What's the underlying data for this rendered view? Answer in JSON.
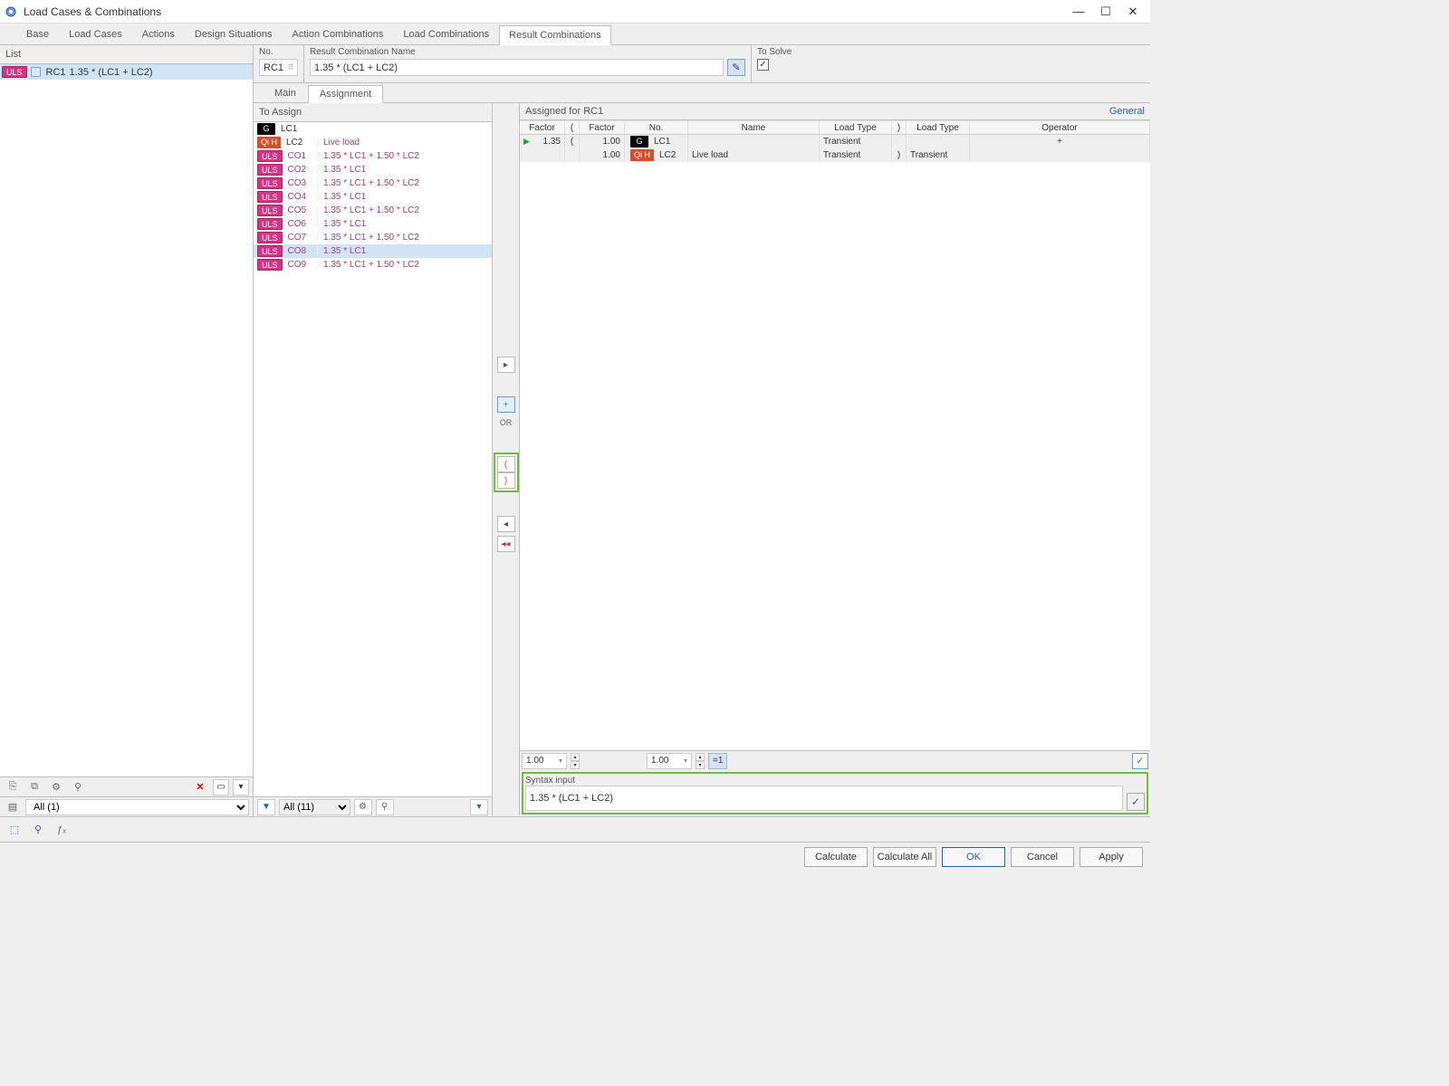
{
  "window": {
    "title": "Load Cases & Combinations"
  },
  "tabs": {
    "items": [
      "Base",
      "Load Cases",
      "Actions",
      "Design Situations",
      "Action Combinations",
      "Load Combinations",
      "Result Combinations"
    ],
    "active": 6
  },
  "list": {
    "header": "List",
    "row": {
      "tag": "ULS",
      "code": "RC1",
      "name": "1.35 * (LC1 + LC2)"
    },
    "filter": "All (1)"
  },
  "header": {
    "no_label": "No.",
    "no_value": "RC1",
    "name_label": "Result Combination Name",
    "name_value": "1.35 * (LC1 + LC2)",
    "solve_label": "To Solve"
  },
  "subtabs": {
    "items": [
      "Main",
      "Assignment"
    ],
    "active": 1
  },
  "to_assign": {
    "header": "To Assign",
    "rows": [
      {
        "tag": "G",
        "code": "LC1",
        "desc": ""
      },
      {
        "tag": "QI",
        "code": "LC2",
        "desc": "Live load"
      },
      {
        "tag": "ULS",
        "code": "CO1",
        "desc": "1.35 * LC1 + 1.50 * LC2"
      },
      {
        "tag": "ULS",
        "code": "CO2",
        "desc": "1.35 * LC1"
      },
      {
        "tag": "ULS",
        "code": "CO3",
        "desc": "1.35 * LC1 + 1.50 * LC2"
      },
      {
        "tag": "ULS",
        "code": "CO4",
        "desc": "1.35 * LC1"
      },
      {
        "tag": "ULS",
        "code": "CO5",
        "desc": "1.35 * LC1 + 1.50 * LC2"
      },
      {
        "tag": "ULS",
        "code": "CO6",
        "desc": "1.35 * LC1"
      },
      {
        "tag": "ULS",
        "code": "CO7",
        "desc": "1.35 * LC1 + 1.50 * LC2"
      },
      {
        "tag": "ULS",
        "code": "CO8",
        "desc": "1.35 * LC1",
        "selected": true
      },
      {
        "tag": "ULS",
        "code": "CO9",
        "desc": "1.35 * LC1 + 1.50 * LC2"
      }
    ],
    "filter": "All (11)"
  },
  "center": {
    "or": "OR",
    "open": "(",
    "close": ")"
  },
  "assigned": {
    "header": "Assigned for RC1",
    "general": "General",
    "columns": [
      "Factor",
      "(",
      "Factor",
      "No.",
      "Name",
      "Load Type",
      ")",
      "Load Type",
      "Operator"
    ],
    "rows": [
      {
        "f1": "1.35",
        "p1": "(",
        "f2": "1.00",
        "tag": "G",
        "no": "LC1",
        "name": "",
        "lt1": "Transient",
        "p2": "",
        "lt2": "",
        "op": "+"
      },
      {
        "f1": "",
        "p1": "",
        "f2": "1.00",
        "tag": "QI",
        "no": "LC2",
        "name": "Live load",
        "lt1": "Transient",
        "p2": ")",
        "lt2": "Transient",
        "op": ""
      }
    ],
    "spin1": "1.00",
    "spin2": "1.00",
    "eq1": "=1"
  },
  "syntax": {
    "label": "Syntax input",
    "value": "1.35 * (LC1 + LC2)"
  },
  "footer": {
    "calc": "Calculate",
    "calc_all": "Calculate All",
    "ok": "OK",
    "cancel": "Cancel",
    "apply": "Apply"
  }
}
